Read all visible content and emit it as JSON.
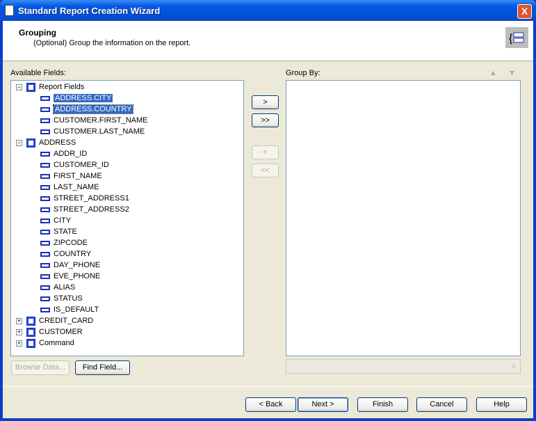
{
  "window": {
    "title": "Standard Report Creation Wizard",
    "close": "X"
  },
  "header": {
    "title": "Grouping",
    "subtitle": "(Optional) Group the information on the report."
  },
  "available": {
    "label": "Available Fields:",
    "tree": [
      {
        "label": "Report Fields",
        "level": 0,
        "expanded": true,
        "icon": "report-fields-icon"
      },
      {
        "label": "ADDRESS.CITY",
        "level": 1,
        "selected": true
      },
      {
        "label": "ADDRESS.COUNTRY",
        "level": 1,
        "selected": true,
        "focused": true
      },
      {
        "label": "CUSTOMER.FIRST_NAME",
        "level": 1
      },
      {
        "label": "CUSTOMER.LAST_NAME",
        "level": 1
      },
      {
        "label": "ADDRESS",
        "level": 0,
        "expanded": true,
        "icon": "table-icon"
      },
      {
        "label": "ADDR_ID",
        "level": 1
      },
      {
        "label": "CUSTOMER_ID",
        "level": 1
      },
      {
        "label": "FIRST_NAME",
        "level": 1
      },
      {
        "label": "LAST_NAME",
        "level": 1
      },
      {
        "label": "STREET_ADDRESS1",
        "level": 1
      },
      {
        "label": "STREET_ADDRESS2",
        "level": 1
      },
      {
        "label": "CITY",
        "level": 1
      },
      {
        "label": "STATE",
        "level": 1
      },
      {
        "label": "ZIPCODE",
        "level": 1
      },
      {
        "label": "COUNTRY",
        "level": 1
      },
      {
        "label": "DAY_PHONE",
        "level": 1
      },
      {
        "label": "EVE_PHONE",
        "level": 1
      },
      {
        "label": "ALIAS",
        "level": 1
      },
      {
        "label": "STATUS",
        "level": 1
      },
      {
        "label": "IS_DEFAULT",
        "level": 1
      },
      {
        "label": "CREDIT_CARD",
        "level": 0,
        "expanded": false,
        "icon": "table-icon"
      },
      {
        "label": "CUSTOMER",
        "level": 0,
        "expanded": false,
        "icon": "table-icon"
      },
      {
        "label": "Command",
        "level": 0,
        "expanded": false,
        "icon": "table-icon"
      }
    ]
  },
  "groupby": {
    "label": "Group By:",
    "items": [],
    "dropdown_value": ""
  },
  "transfer": {
    "add": ">",
    "add_all": ">>",
    "remove": "<",
    "remove_all": "<<"
  },
  "buttons": {
    "browse": "Browse Data...",
    "find": "Find Field...",
    "back": "< Back",
    "next": "Next >",
    "finish": "Finish",
    "cancel": "Cancel",
    "help": "Help"
  },
  "colors": {
    "titlebar": "#0458e0",
    "selection": "#316ac5",
    "dialog": "#ece9d8"
  }
}
